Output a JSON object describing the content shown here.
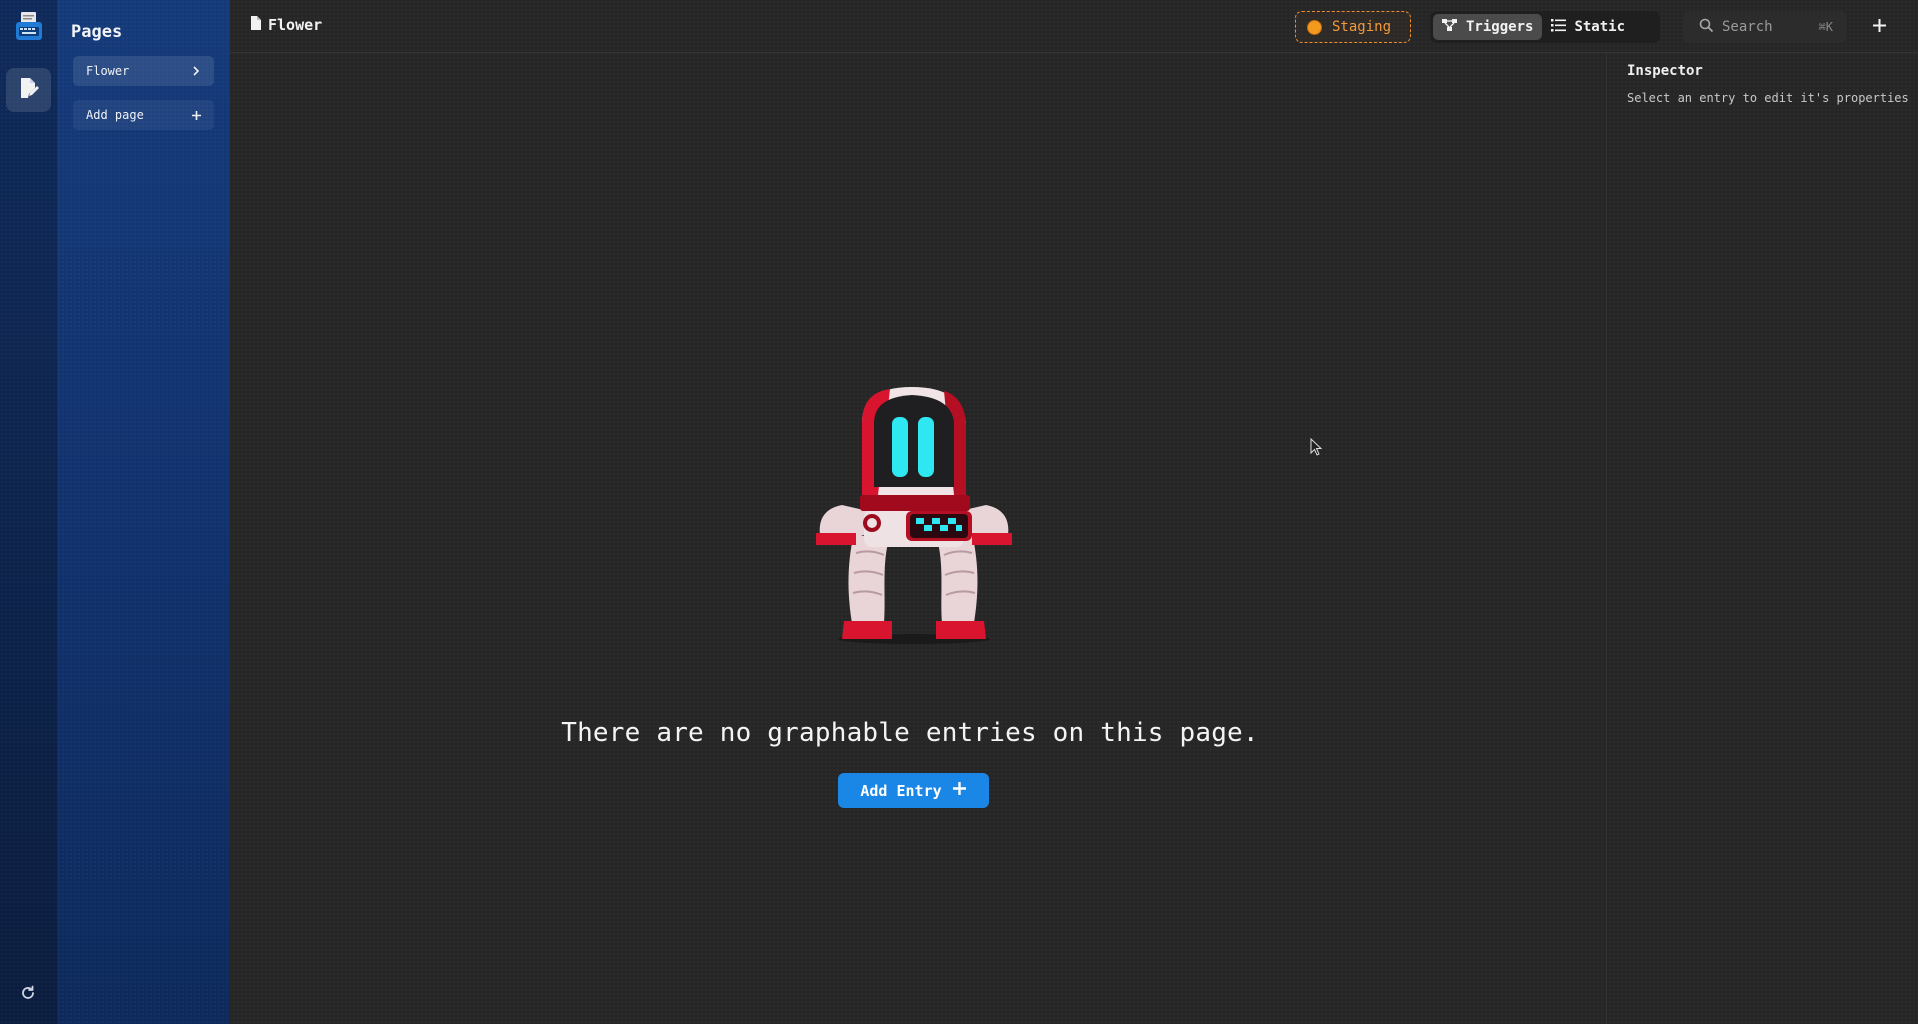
{
  "sidebar": {
    "title": "Pages",
    "items": [
      {
        "label": "Flower"
      },
      {
        "label": "Add page"
      }
    ]
  },
  "topbar": {
    "breadcrumb": "Flower",
    "environment": "Staging",
    "view_options": [
      {
        "label": "Triggers",
        "icon": "graph-icon",
        "selected": true
      },
      {
        "label": "Static",
        "icon": "list-icon",
        "selected": false
      }
    ],
    "search": {
      "placeholder": "Search",
      "shortcut": "⌘K"
    }
  },
  "inspector": {
    "title": "Inspector",
    "hint": "Select an entry to edit it's properties"
  },
  "empty_state": {
    "message": "There are no graphable entries on this page.",
    "button_label": "Add Entry"
  },
  "colors": {
    "accent": "#1a86e6",
    "environment": "#f28c28",
    "sidebar": "#153a7a",
    "canvas": "#262626"
  }
}
